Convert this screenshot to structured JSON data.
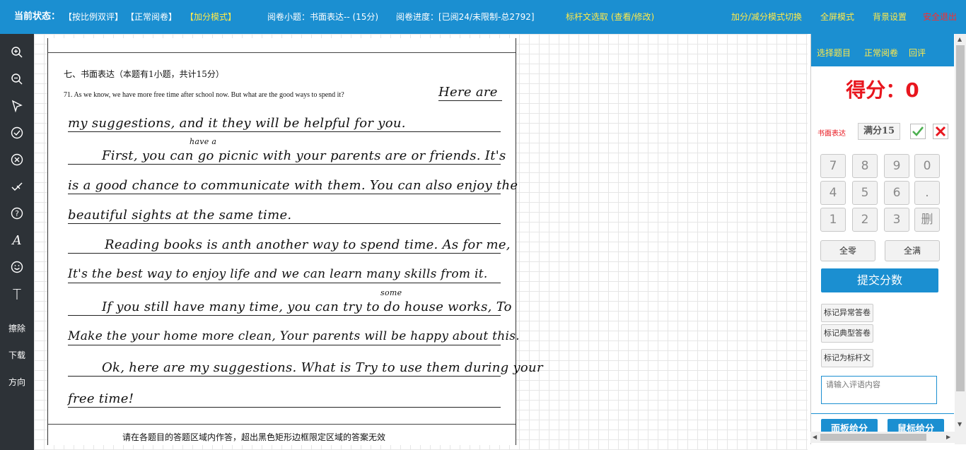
{
  "topbar": {
    "status_label": "当前状态：",
    "mode_ratio": "【按比例双评】",
    "mode_normal": "【正常阅卷】",
    "mode_add": "【加分模式】",
    "question_info": "阅卷小题：书面表达-- (15分)",
    "progress": "阅卷进度：[已阅24/未限制-总2792]",
    "benchmark": "标杆文选取 (查看/修改)",
    "toggle_mode": "加分/减分模式切换",
    "fullscreen": "全屏模式",
    "background": "背景设置",
    "logout": "安全退出"
  },
  "toolbar": {
    "items": [
      {
        "icon": "zoom-in-icon",
        "glyph": "⊕"
      },
      {
        "icon": "zoom-out-icon",
        "glyph": "⊖"
      },
      {
        "icon": "pointer-icon",
        "glyph": "▷"
      },
      {
        "icon": "check-circle-icon",
        "glyph": "✓"
      },
      {
        "icon": "x-circle-icon",
        "glyph": "✕"
      },
      {
        "icon": "half-check-icon",
        "glyph": "✓"
      },
      {
        "icon": "question-circle-icon",
        "glyph": "?"
      },
      {
        "icon": "script-a-icon",
        "glyph": "𝒜"
      },
      {
        "icon": "smiley-icon",
        "glyph": "☺"
      },
      {
        "icon": "text-tool-icon",
        "glyph": "T"
      }
    ],
    "erase": "擦除",
    "download": "下载",
    "direction": "方向"
  },
  "paper": {
    "section_title": "七、书面表达（本题有1小题，共计15分）",
    "prompt": "71. As we know, we have more free time after school now. But what are the good ways to spend it?",
    "prompt_answer": "Here are",
    "annotation_have_a": "have a",
    "annotation_some": "some",
    "handwriting": [
      "my suggestions, and it they will be helpful for you.",
      "First, you can go picnic with your parents are or friends. It's",
      "is a good chance to communicate with them. You can also enjoy the",
      "beautiful sights at the same time.",
      "Reading books is anth another way to spend time. As for me,",
      "It's the best way to enjoy life and we can learn many skills from it.",
      "If you still have many time, you can try to do house works, To",
      "Make the your home more clean, Your parents will be happy about this.",
      "Ok, here are my suggestions. What is Try to use them during your",
      "free time!"
    ],
    "footer": "请在各题目的答题区域内作答，超出黑色矩形边框限定区域的答案无效"
  },
  "panel": {
    "tabs": [
      "选择题目",
      "正常阅卷",
      "回评"
    ],
    "score_text": "得分：0",
    "item_label": "书面表达",
    "full_score": "满分15",
    "keypad": [
      "7",
      "8",
      "9",
      "0",
      "4",
      "5",
      "6",
      ".",
      "1",
      "2",
      "3",
      "删"
    ],
    "all_zero": "全零",
    "all_full": "全满",
    "submit": "提交分数",
    "mark_abnormal": "标记异常答卷",
    "mark_typical": "标记典型答卷",
    "mark_benchmark": "标记为标杆文",
    "comment_placeholder": "请输入评语内容",
    "bottom_left": "面板给分",
    "bottom_right": "鼠标给分"
  },
  "colors": {
    "accent_blue": "#1b8fd1",
    "score_red": "#e8161e",
    "link_yellow": "#ffe94a",
    "toolbar_dark": "#2d3237"
  }
}
